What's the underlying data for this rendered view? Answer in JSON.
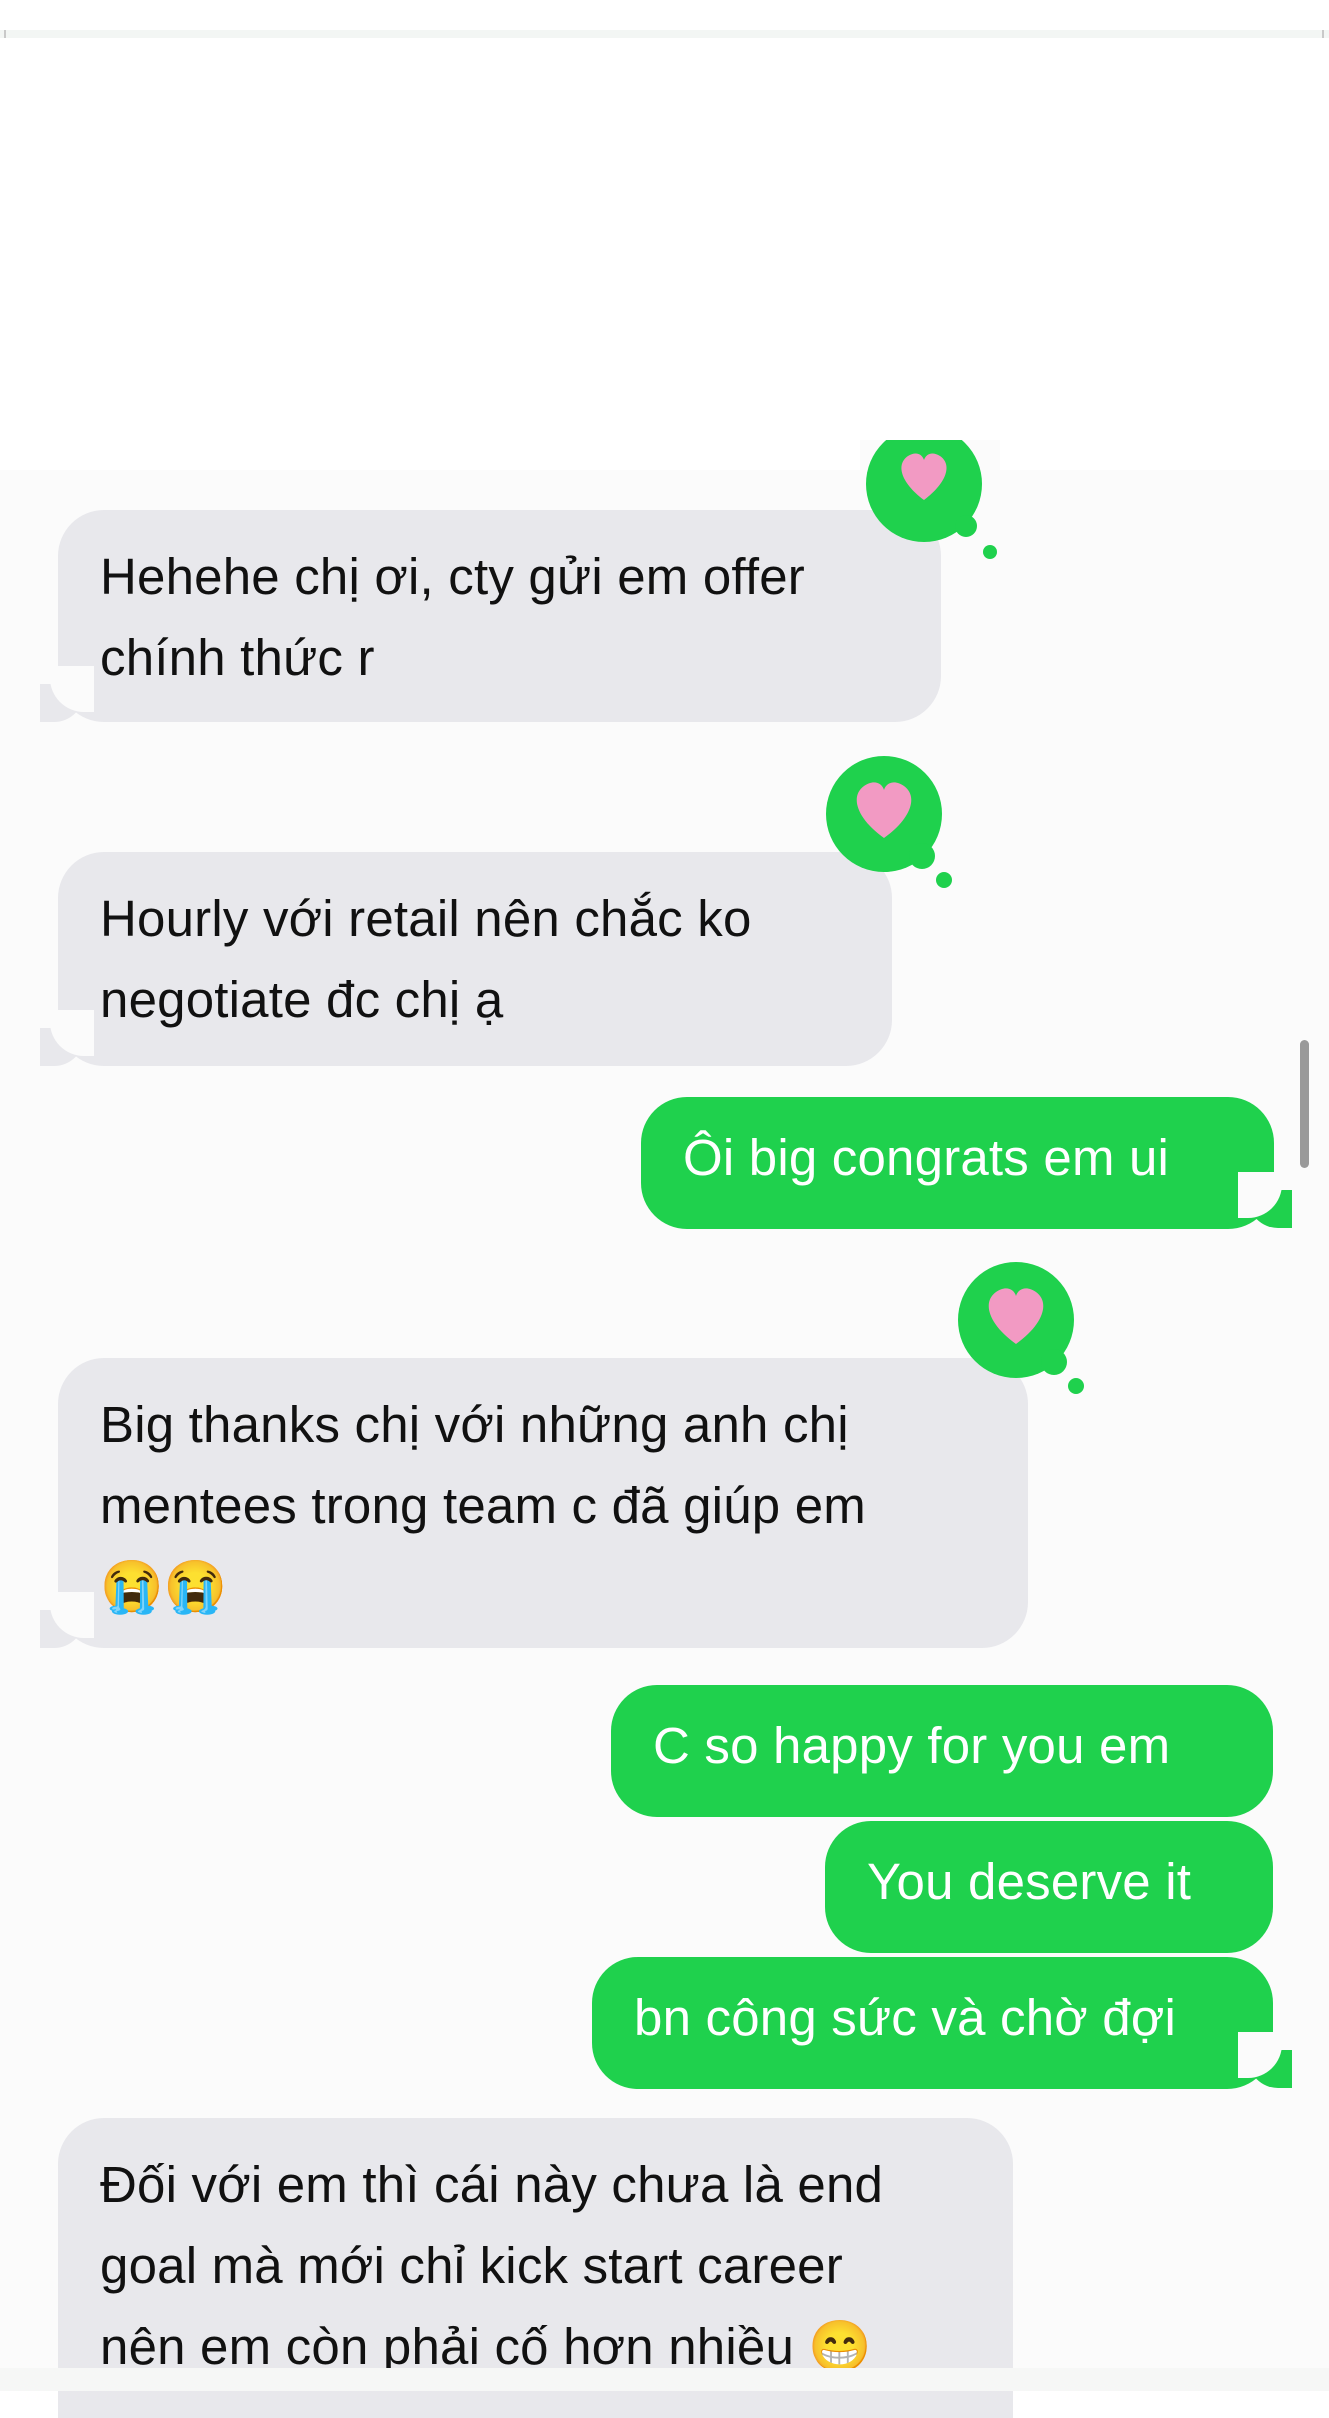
{
  "colors": {
    "received_bubble": "#e8e8ec",
    "sent_bubble": "#1fd14d",
    "tapback_bg": "#1fd14d",
    "heart": "#f29ac3"
  },
  "messages": [
    {
      "id": "m1",
      "direction": "received",
      "lines": [
        "Hehehe chị ơi, cty gửi em offer",
        "chính thức r"
      ],
      "reaction": "heart-icon"
    },
    {
      "id": "m2",
      "direction": "received",
      "lines": [
        "Hourly  với retail nên chắc ko",
        "negotiate đc chị ạ"
      ],
      "reaction": "heart-icon"
    },
    {
      "id": "m3",
      "direction": "sent",
      "lines": [
        "Ôi big congrats em ui"
      ]
    },
    {
      "id": "m4",
      "direction": "received",
      "lines": [
        "Big thanks chị với những anh chị",
        "mentees  trong team c đã giúp em",
        "😭😭"
      ],
      "reaction": "heart-icon"
    },
    {
      "id": "m5",
      "direction": "sent",
      "lines": [
        "C so happy for you em"
      ]
    },
    {
      "id": "m6",
      "direction": "sent",
      "lines": [
        "You deserve it"
      ]
    },
    {
      "id": "m7",
      "direction": "sent",
      "lines": [
        "bn công sức và chờ đợi"
      ]
    },
    {
      "id": "m8",
      "direction": "received",
      "lines": [
        "Đối với em thì cái này chưa là end",
        "goal mà mới chỉ kick start career",
        "nên em còn phải cố hơn nhiều 😁"
      ]
    }
  ]
}
